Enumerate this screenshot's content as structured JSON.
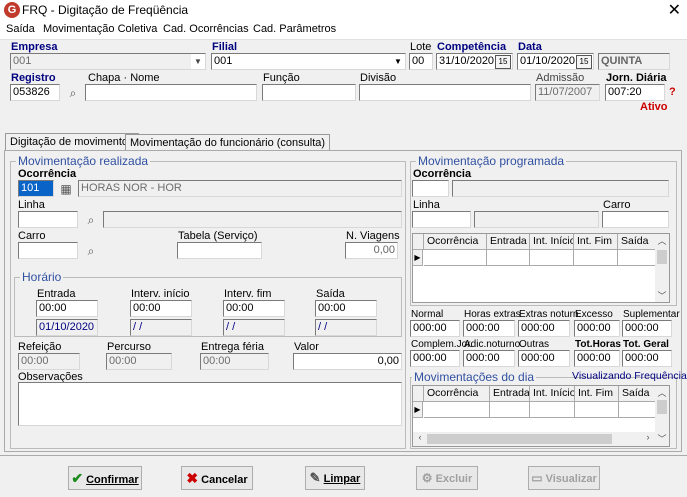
{
  "window": {
    "title": "FRQ - Digitação de Freqüência",
    "app_icon": "G"
  },
  "menu": [
    "Saída",
    "Movimentação Coletiva",
    "Cad. Ocorrências",
    "Cad. Parâmetros"
  ],
  "header": {
    "empresa": {
      "label": "Empresa",
      "value": "001"
    },
    "filial": {
      "label": "Filial",
      "value": "001"
    },
    "lote": {
      "label": "Lote",
      "value": "00"
    },
    "competencia": {
      "label": "Competência",
      "value": "31/10/2020"
    },
    "data": {
      "label": "Data",
      "value": "01/10/2020",
      "weekday": "QUINTA"
    },
    "registro": {
      "label": "Registro",
      "value": "053826"
    },
    "chapa_nome": {
      "label": "Chapa · Nome",
      "value": ""
    },
    "funcao": {
      "label": "Função",
      "value": ""
    },
    "divisao": {
      "label": "Divisão",
      "value": ""
    },
    "admissao": {
      "label": "Admissão",
      "value": "11/07/2007"
    },
    "jorn_diaria": {
      "label": "Jorn. Diária",
      "value": "007:20",
      "help": "?"
    },
    "status": "Ativo"
  },
  "tabs": [
    {
      "label": "Digitação de movimentos",
      "active": true
    },
    {
      "label": "Movimentação do funcionário (consulta)",
      "active": false
    }
  ],
  "realizada": {
    "title": "Movimentação realizada",
    "ocorrencia": {
      "label": "Ocorrência",
      "code": "101",
      "desc": "HORAS NOR - HOR"
    },
    "linha": {
      "label": "Linha",
      "value": ""
    },
    "carro": {
      "label": "Carro",
      "value": ""
    },
    "tabela": {
      "label": "Tabela (Serviço)",
      "value": ""
    },
    "n_viagens": {
      "label": "N. Viagens",
      "value": "0,00"
    },
    "horario": {
      "title": "Horário",
      "entrada": {
        "label": "Entrada",
        "time": "00:00",
        "date": "01/10/2020"
      },
      "interv_inicio": {
        "label": "Interv. início",
        "time": "00:00",
        "date": " / /"
      },
      "interv_fim": {
        "label": "Interv. fim",
        "time": "00:00",
        "date": " / /"
      },
      "saida": {
        "label": "Saída",
        "time": "00:00",
        "date": " / /"
      }
    },
    "refeicao": {
      "label": "Refeição",
      "value": "00:00"
    },
    "percurso": {
      "label": "Percurso",
      "value": "00:00"
    },
    "entrega_feria": {
      "label": "Entrega féria",
      "value": "00:00"
    },
    "valor": {
      "label": "Valor",
      "value": "0,00"
    },
    "observacoes": {
      "label": "Observações",
      "value": ""
    }
  },
  "programada": {
    "title": "Movimentação programada",
    "ocorrencia_label": "Ocorrência",
    "linha_label": "Linha",
    "carro_label": "Carro",
    "grid_headers": [
      "Ocorrência",
      "Entrada",
      "Int. Início",
      "Int. Fim",
      "Saída"
    ]
  },
  "totais": {
    "row1": [
      {
        "label": "Normal",
        "value": "000:00"
      },
      {
        "label": "Horas extras",
        "value": "000:00"
      },
      {
        "label": "Extras noturn.",
        "value": "000:00"
      },
      {
        "label": "Excesso",
        "value": "000:00"
      },
      {
        "label": "Suplementar",
        "value": "000:00"
      }
    ],
    "row2": [
      {
        "label": "Complem.Jor.",
        "value": "000:00"
      },
      {
        "label": "Adic.noturno",
        "value": "000:00"
      },
      {
        "label": "Outras",
        "value": "000:00"
      },
      {
        "label": "Tot.Horas",
        "value": "000:00"
      },
      {
        "label": "Tot. Geral",
        "value": "000:00"
      }
    ]
  },
  "movimentacoes_dia": {
    "title": "Movimentações do dia",
    "status": "Visualizando Frequência",
    "grid_headers": [
      "Ocorrência",
      "Entrada",
      "Int. Início",
      "Int. Fim",
      "Saída"
    ]
  },
  "buttons": {
    "confirmar": "Confirmar",
    "cancelar": "Cancelar",
    "limpar": "Limpar",
    "excluir": "Excluir",
    "visualizar": "Visualizar"
  },
  "colors": {
    "label_blue": "#000080",
    "group_title": "#3050a0",
    "status_red": "#cc0000",
    "confirm_green": "#1a8a1a",
    "cancel_red": "#cc0000"
  }
}
